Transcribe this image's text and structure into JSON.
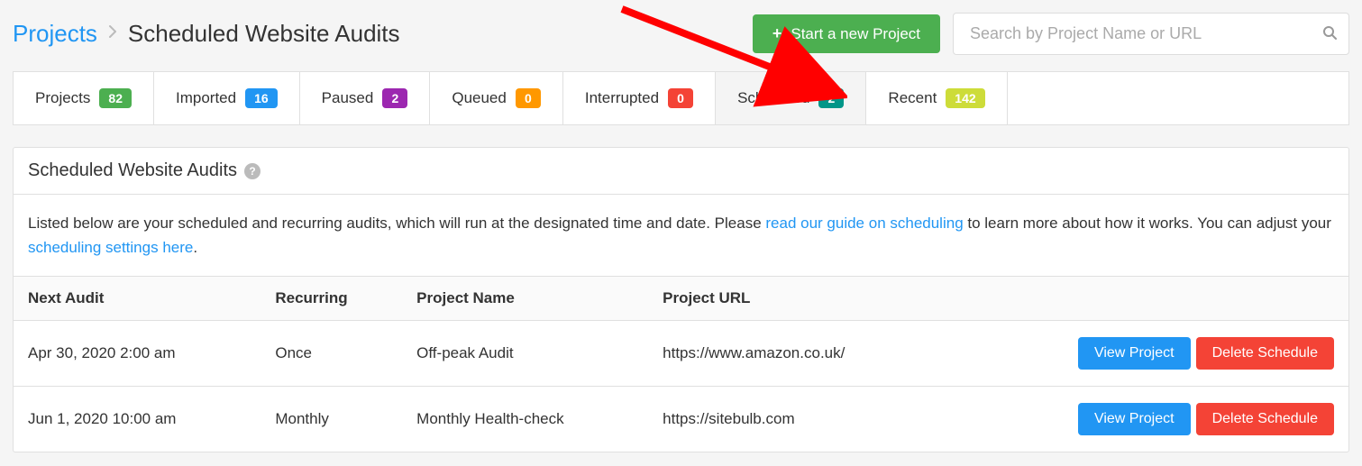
{
  "breadcrumb": {
    "root": "Projects",
    "current": "Scheduled Website Audits"
  },
  "header": {
    "new_project_label": "Start a new Project",
    "search_placeholder": "Search by Project Name or URL"
  },
  "tabs": [
    {
      "label": "Projects",
      "count": "82",
      "color": "b-green"
    },
    {
      "label": "Imported",
      "count": "16",
      "color": "b-blue"
    },
    {
      "label": "Paused",
      "count": "2",
      "color": "b-purple"
    },
    {
      "label": "Queued",
      "count": "0",
      "color": "b-orange"
    },
    {
      "label": "Interrupted",
      "count": "0",
      "color": "b-red"
    },
    {
      "label": "Scheduled",
      "count": "2",
      "color": "b-teal",
      "active": true
    },
    {
      "label": "Recent",
      "count": "142",
      "color": "b-lime"
    }
  ],
  "panel": {
    "title": "Scheduled Website Audits",
    "desc_before": "Listed below are your scheduled and recurring audits, which will run at the designated time and date. Please ",
    "link1": "read our guide on scheduling",
    "desc_mid": " to learn more about how it works. You can adjust your ",
    "link2": "scheduling settings here",
    "desc_after": "."
  },
  "table": {
    "headers": {
      "next_audit": "Next Audit",
      "recurring": "Recurring",
      "project_name": "Project Name",
      "project_url": "Project URL"
    },
    "rows": [
      {
        "next_audit": "Apr 30, 2020 2:00 am",
        "recurring": "Once",
        "project_name": "Off-peak Audit",
        "project_url": "https://www.amazon.co.uk/"
      },
      {
        "next_audit": "Jun 1, 2020 10:00 am",
        "recurring": "Monthly",
        "project_name": "Monthly Health-check",
        "project_url": "https://sitebulb.com"
      }
    ],
    "actions": {
      "view": "View Project",
      "delete": "Delete Schedule"
    }
  }
}
